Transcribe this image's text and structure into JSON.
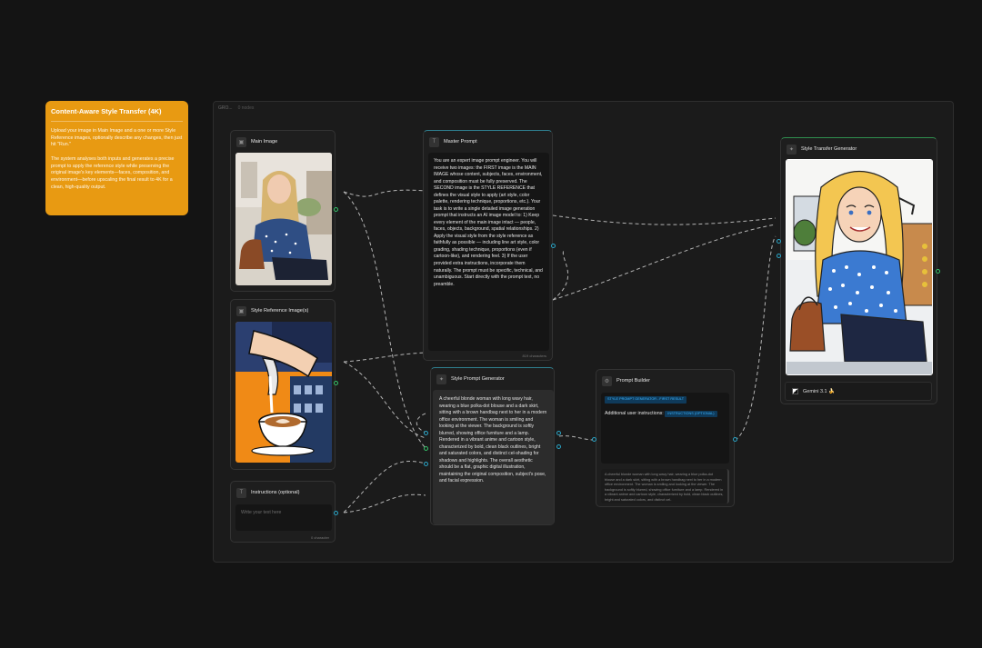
{
  "note": {
    "title": "Content-Aware Style Transfer (4K)",
    "para1": "Upload your image in Main Image and a one or more Style Reference images, optionally describe any changes, then just hit \"Run.\"",
    "para2": "The system analyses both inputs and generates a precise prompt to apply the reference style while preserving the original image's key elements—faces, composition, and environment—before upscaling the final result to 4K for a clean, high-quality output."
  },
  "group": {
    "title": "GRO...",
    "subtitle": "0 nodes"
  },
  "main_image": {
    "title": "Main Image"
  },
  "style_ref": {
    "title": "Style Reference Image(s)"
  },
  "instructions": {
    "title": "Instructions (optional)",
    "placeholder": "Write your text here",
    "counter": "0 character"
  },
  "master_prompt": {
    "title": "Master Prompt",
    "text": "You are an expert image prompt engineer. You will receive two images: the FIRST image is the MAIN IMAGE whose content, subjects, faces, environment, and composition must be fully preserved. The SECOND image is the STYLE REFERENCE that defines the visual style to apply (art style, color palette, rendering technique, proportions, etc.). Your task is to write a single detailed image generation prompt that instructs an AI image model to: 1) Keep every element of the main image intact — people, faces, objects, background, spatial relationships. 2) Apply the visual style from the style reference as faithfully as possible — including line art style, color grading, shading technique, proportions (even if cartoon-like), and rendering feel. 3) If the user provided extra instructions, incorporate them naturally. The prompt must be specific, technical, and unambiguous. Start directly with the prompt text, no preamble.",
    "counter": "819 characters"
  },
  "style_prompt_gen": {
    "title": "Style Prompt Generator",
    "text": "A cheerful blonde woman with long wavy hair, wearing a blue polka-dot blouse and a dark skirt, sitting with a brown handbag next to her in a modern office environment. The woman is smiling and looking at the viewer. The background is softly blurred, showing office furniture and a lamp. Rendered in a vibrant anime and cartoon style, characterized by bold, clean black outlines, bright and saturated colors, and distinct cel-shading for shadows and highlights. The overall aesthetic should be a flat, graphic digital illustration, maintaining the original composition, subject's pose, and facial expression."
  },
  "prompt_builder": {
    "title": "Prompt Builder",
    "badge1": "STYLE PROMPT GENERATOR - FIRST RESULT",
    "label": "Additional user instructions:",
    "badge2": "INSTRUCTIONS (OPTIONAL)",
    "preview": "A cheerful blonde woman with long wavy hair, wearing a blue polka-dot blouse and a dark skirt, sitting with a brown handbag next to her in a modern office environment. The woman is smiling and looking at the viewer. The background is softly blurred, showing office furniture and a lamp. Rendered in a vibrant anime and cartoon style, characterized by bold, clean black outlines, bright and saturated colors, and distinct cel-"
  },
  "generator": {
    "title": "Style Transfer Generator",
    "model": "Gemini 3.1 🍌"
  }
}
